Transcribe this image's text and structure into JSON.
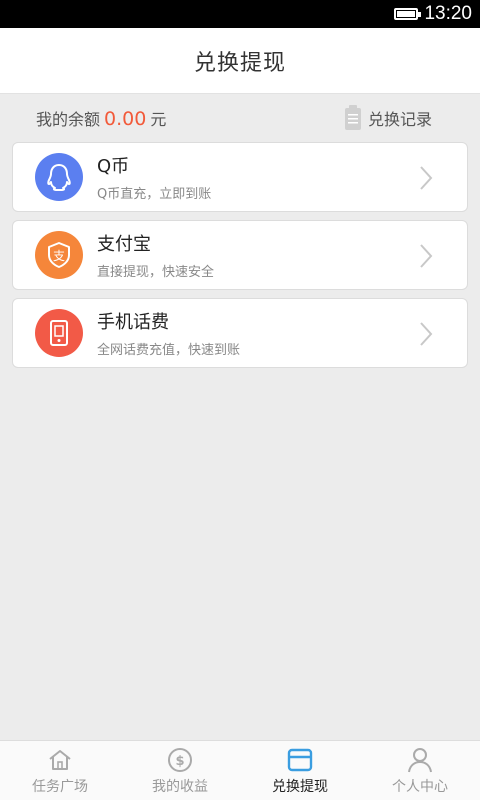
{
  "status_bar": {
    "time": "13:20"
  },
  "header": {
    "title": "兑换提现"
  },
  "balance": {
    "label": "我的余额",
    "amount": "0.00",
    "unit": "元",
    "history_label": "兑换记录"
  },
  "options": [
    {
      "title": "Q币",
      "subtitle": "Q币直充，立即到账",
      "icon": "qq-penguin-icon",
      "color": "#5b7ff0"
    },
    {
      "title": "支付宝",
      "subtitle": "直接提现，快速安全",
      "icon": "alipay-icon",
      "color": "#f5863a"
    },
    {
      "title": "手机话费",
      "subtitle": "全网话费充值，快速到账",
      "icon": "phone-icon",
      "color": "#f25a47"
    }
  ],
  "nav": {
    "items": [
      {
        "label": "任务广场",
        "icon": "home-icon"
      },
      {
        "label": "我的收益",
        "icon": "coin-icon"
      },
      {
        "label": "兑换提现",
        "icon": "wallet-icon",
        "active": true
      },
      {
        "label": "个人中心",
        "icon": "person-icon"
      }
    ],
    "active_color": "#3a9de0"
  }
}
